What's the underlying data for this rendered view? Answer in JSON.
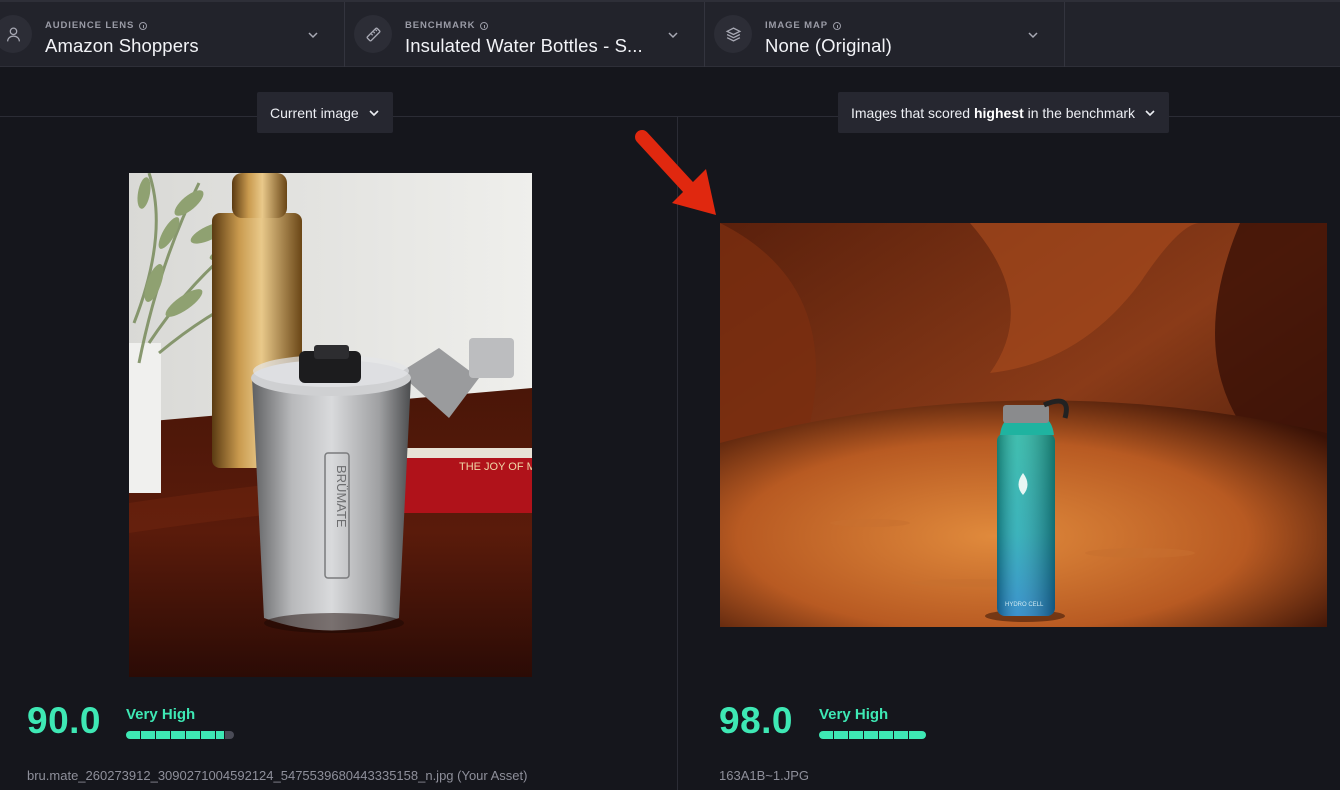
{
  "topbar": {
    "audience_lens": {
      "label": "AUDIENCE LENS",
      "value": "Amazon Shoppers"
    },
    "benchmark": {
      "label": "BENCHMARK",
      "value": "Insulated Water Bottles - S..."
    },
    "image_map": {
      "label": "IMAGE MAP",
      "value": "None (Original)"
    }
  },
  "left_panel": {
    "dropdown_label": "Current image",
    "score": "90.0",
    "rating": "Very High",
    "filename": "bru.mate_260273912_3090271004592124_5475539680443335158_n.jpg (Your Asset)",
    "photo_text": {
      "brand": "BRÜMATE",
      "book_title": "THE JOY OF MIX"
    }
  },
  "right_panel": {
    "dropdown_prefix": "Images that scored",
    "dropdown_bold": "highest",
    "dropdown_suffix": "in the benchmark",
    "score": "98.0",
    "rating": "Very High",
    "filename": "163A1B~1.JPG",
    "photo_text": {
      "brand": "HYDRO CELL"
    }
  },
  "colors": {
    "accent": "#3ee8b4",
    "background": "#15161c",
    "topbar": "#22232b",
    "annotation_arrow": "#e0280f"
  },
  "icons": {
    "audience_lens": "user-icon",
    "benchmark": "ruler-icon",
    "image_map": "layers-icon",
    "dropdowns": "chevron-down-icon"
  }
}
